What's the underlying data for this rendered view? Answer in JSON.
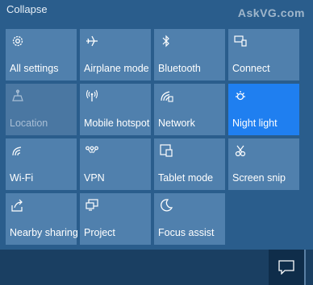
{
  "header": {
    "collapse_label": "Collapse",
    "watermark": "AskVG.com"
  },
  "tiles": [
    {
      "label": "All settings",
      "icon": "gear-icon",
      "state": "normal"
    },
    {
      "label": "Airplane mode",
      "icon": "airplane-icon",
      "state": "normal"
    },
    {
      "label": "Bluetooth",
      "icon": "bluetooth-icon",
      "state": "normal"
    },
    {
      "label": "Connect",
      "icon": "connect-icon",
      "state": "normal"
    },
    {
      "label": "Location",
      "icon": "location-icon",
      "state": "disabled"
    },
    {
      "label": "Mobile hotspot",
      "icon": "hotspot-icon",
      "state": "normal"
    },
    {
      "label": "Network",
      "icon": "network-icon",
      "state": "normal"
    },
    {
      "label": "Night light",
      "icon": "night-light-icon",
      "state": "active"
    },
    {
      "label": "Wi-Fi",
      "icon": "wifi-icon",
      "state": "normal"
    },
    {
      "label": "VPN",
      "icon": "vpn-icon",
      "state": "normal"
    },
    {
      "label": "Tablet mode",
      "icon": "tablet-mode-icon",
      "state": "normal"
    },
    {
      "label": "Screen snip",
      "icon": "screen-snip-icon",
      "state": "normal"
    },
    {
      "label": "Nearby sharing",
      "icon": "nearby-sharing-icon",
      "state": "normal"
    },
    {
      "label": "Project",
      "icon": "project-icon",
      "state": "normal"
    },
    {
      "label": "Focus assist",
      "icon": "moon-icon",
      "state": "normal"
    }
  ],
  "colors": {
    "tile": "#5080ad",
    "tile_active": "#1f7ff0",
    "panel": "#2a5d8c"
  },
  "taskbar": {
    "action_center_icon": "action-center-icon"
  }
}
